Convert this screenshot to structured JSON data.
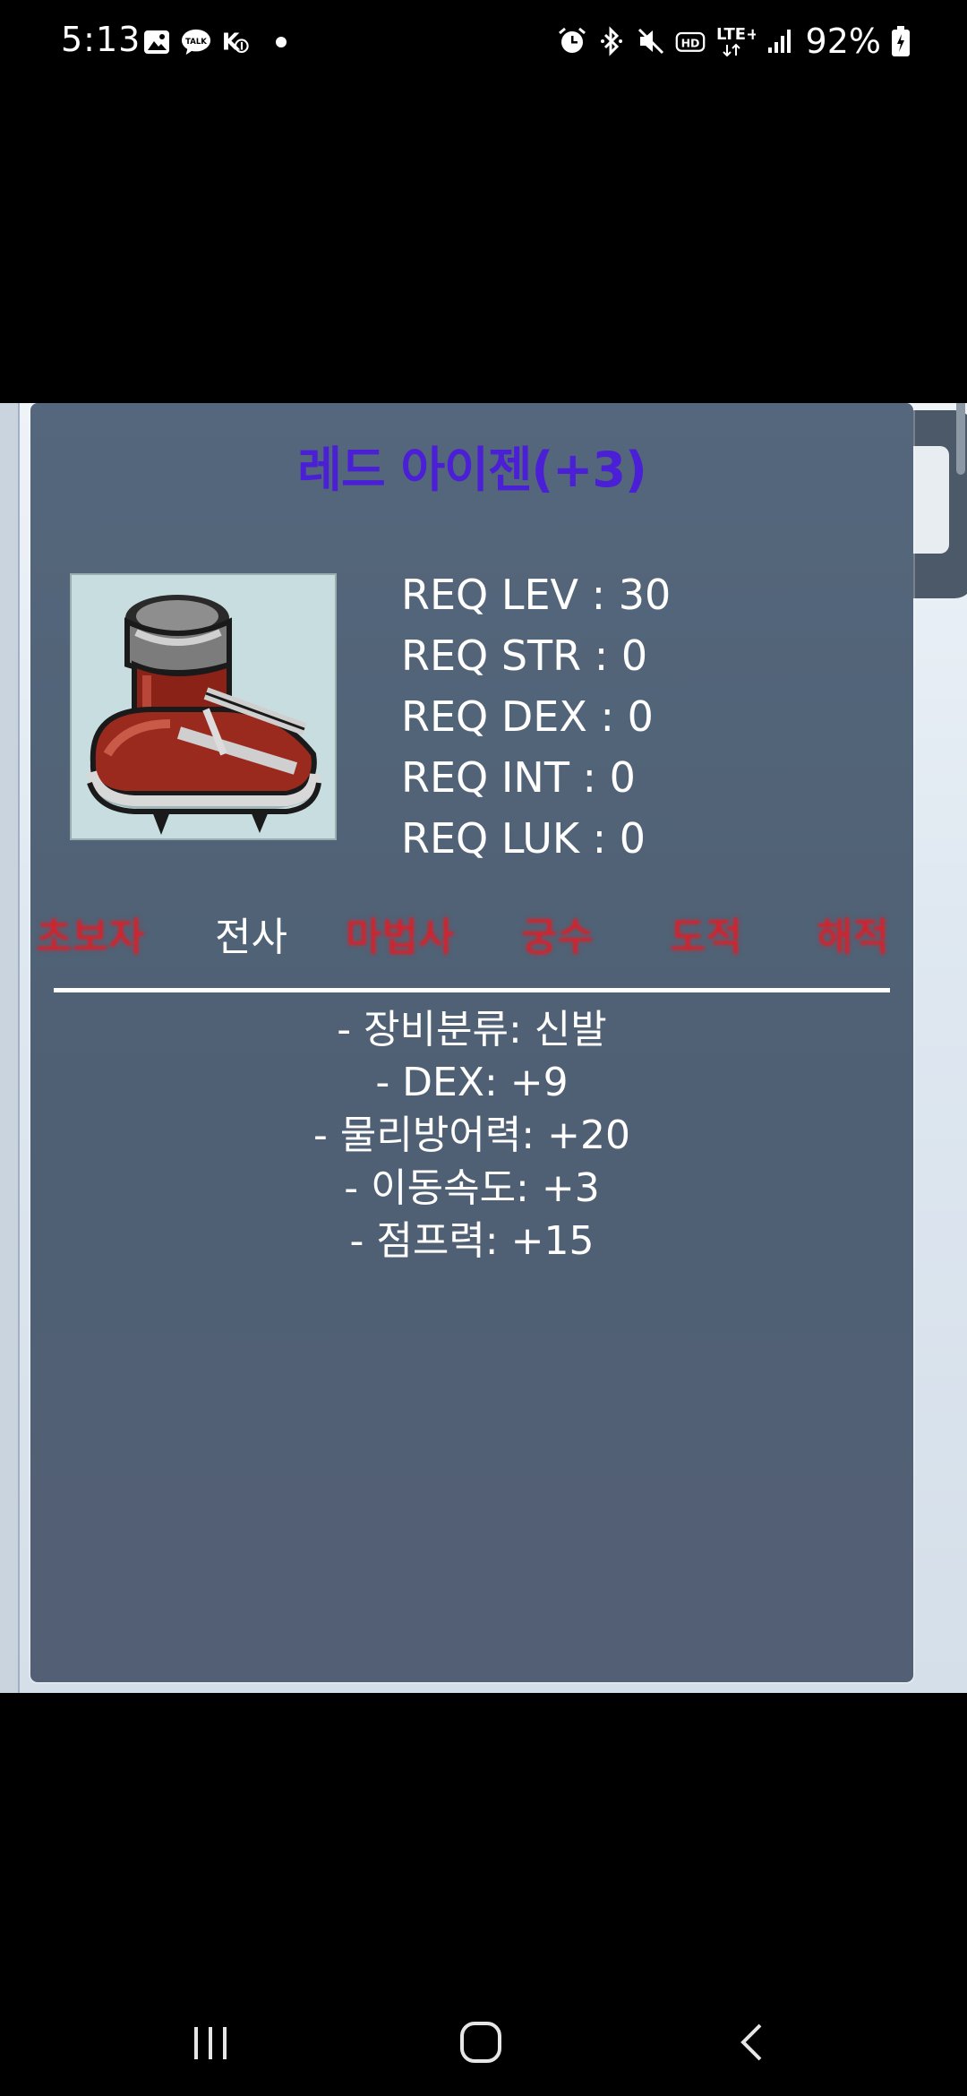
{
  "status_bar": {
    "time": "5:13",
    "battery": "92%",
    "left_icons": [
      "gallery-icon",
      "kakaotalk-icon",
      "k-notification-icon"
    ],
    "right_icons": [
      "alarm-icon",
      "bluetooth-icon",
      "mute-icon",
      "hd-voice-icon",
      "lte-icon",
      "signal-icon",
      "battery-icon"
    ],
    "kakao_label": "TALK",
    "hd_label": "HD",
    "lte_label": "LTE+"
  },
  "tooltip": {
    "title": "레드 아이젠(+3)",
    "item_icon": "red-boots-icon",
    "requirements": [
      "REQ LEV : 30",
      "REQ STR : 0",
      "REQ DEX : 0",
      "REQ INT : 0",
      "REQ LUK : 0"
    ],
    "jobs": [
      {
        "label": "초보자",
        "active": false
      },
      {
        "label": "전사",
        "active": true
      },
      {
        "label": "마법사",
        "active": false
      },
      {
        "label": "궁수",
        "active": false
      },
      {
        "label": "도적",
        "active": false
      },
      {
        "label": "해적",
        "active": false
      }
    ],
    "stats": [
      "- 장비분류: 신발",
      "- DEX: +9",
      "- 물리방어력: +20",
      "- 이동속도: +3",
      "- 점프력: +15"
    ],
    "colors": {
      "title": "#4a1fd6",
      "job_inactive": "#d8202a",
      "job_active": "#ffffff",
      "panel": "#55677c"
    }
  },
  "nav_bar": {
    "buttons": [
      "recent-apps-icon",
      "home-icon",
      "back-icon"
    ]
  }
}
